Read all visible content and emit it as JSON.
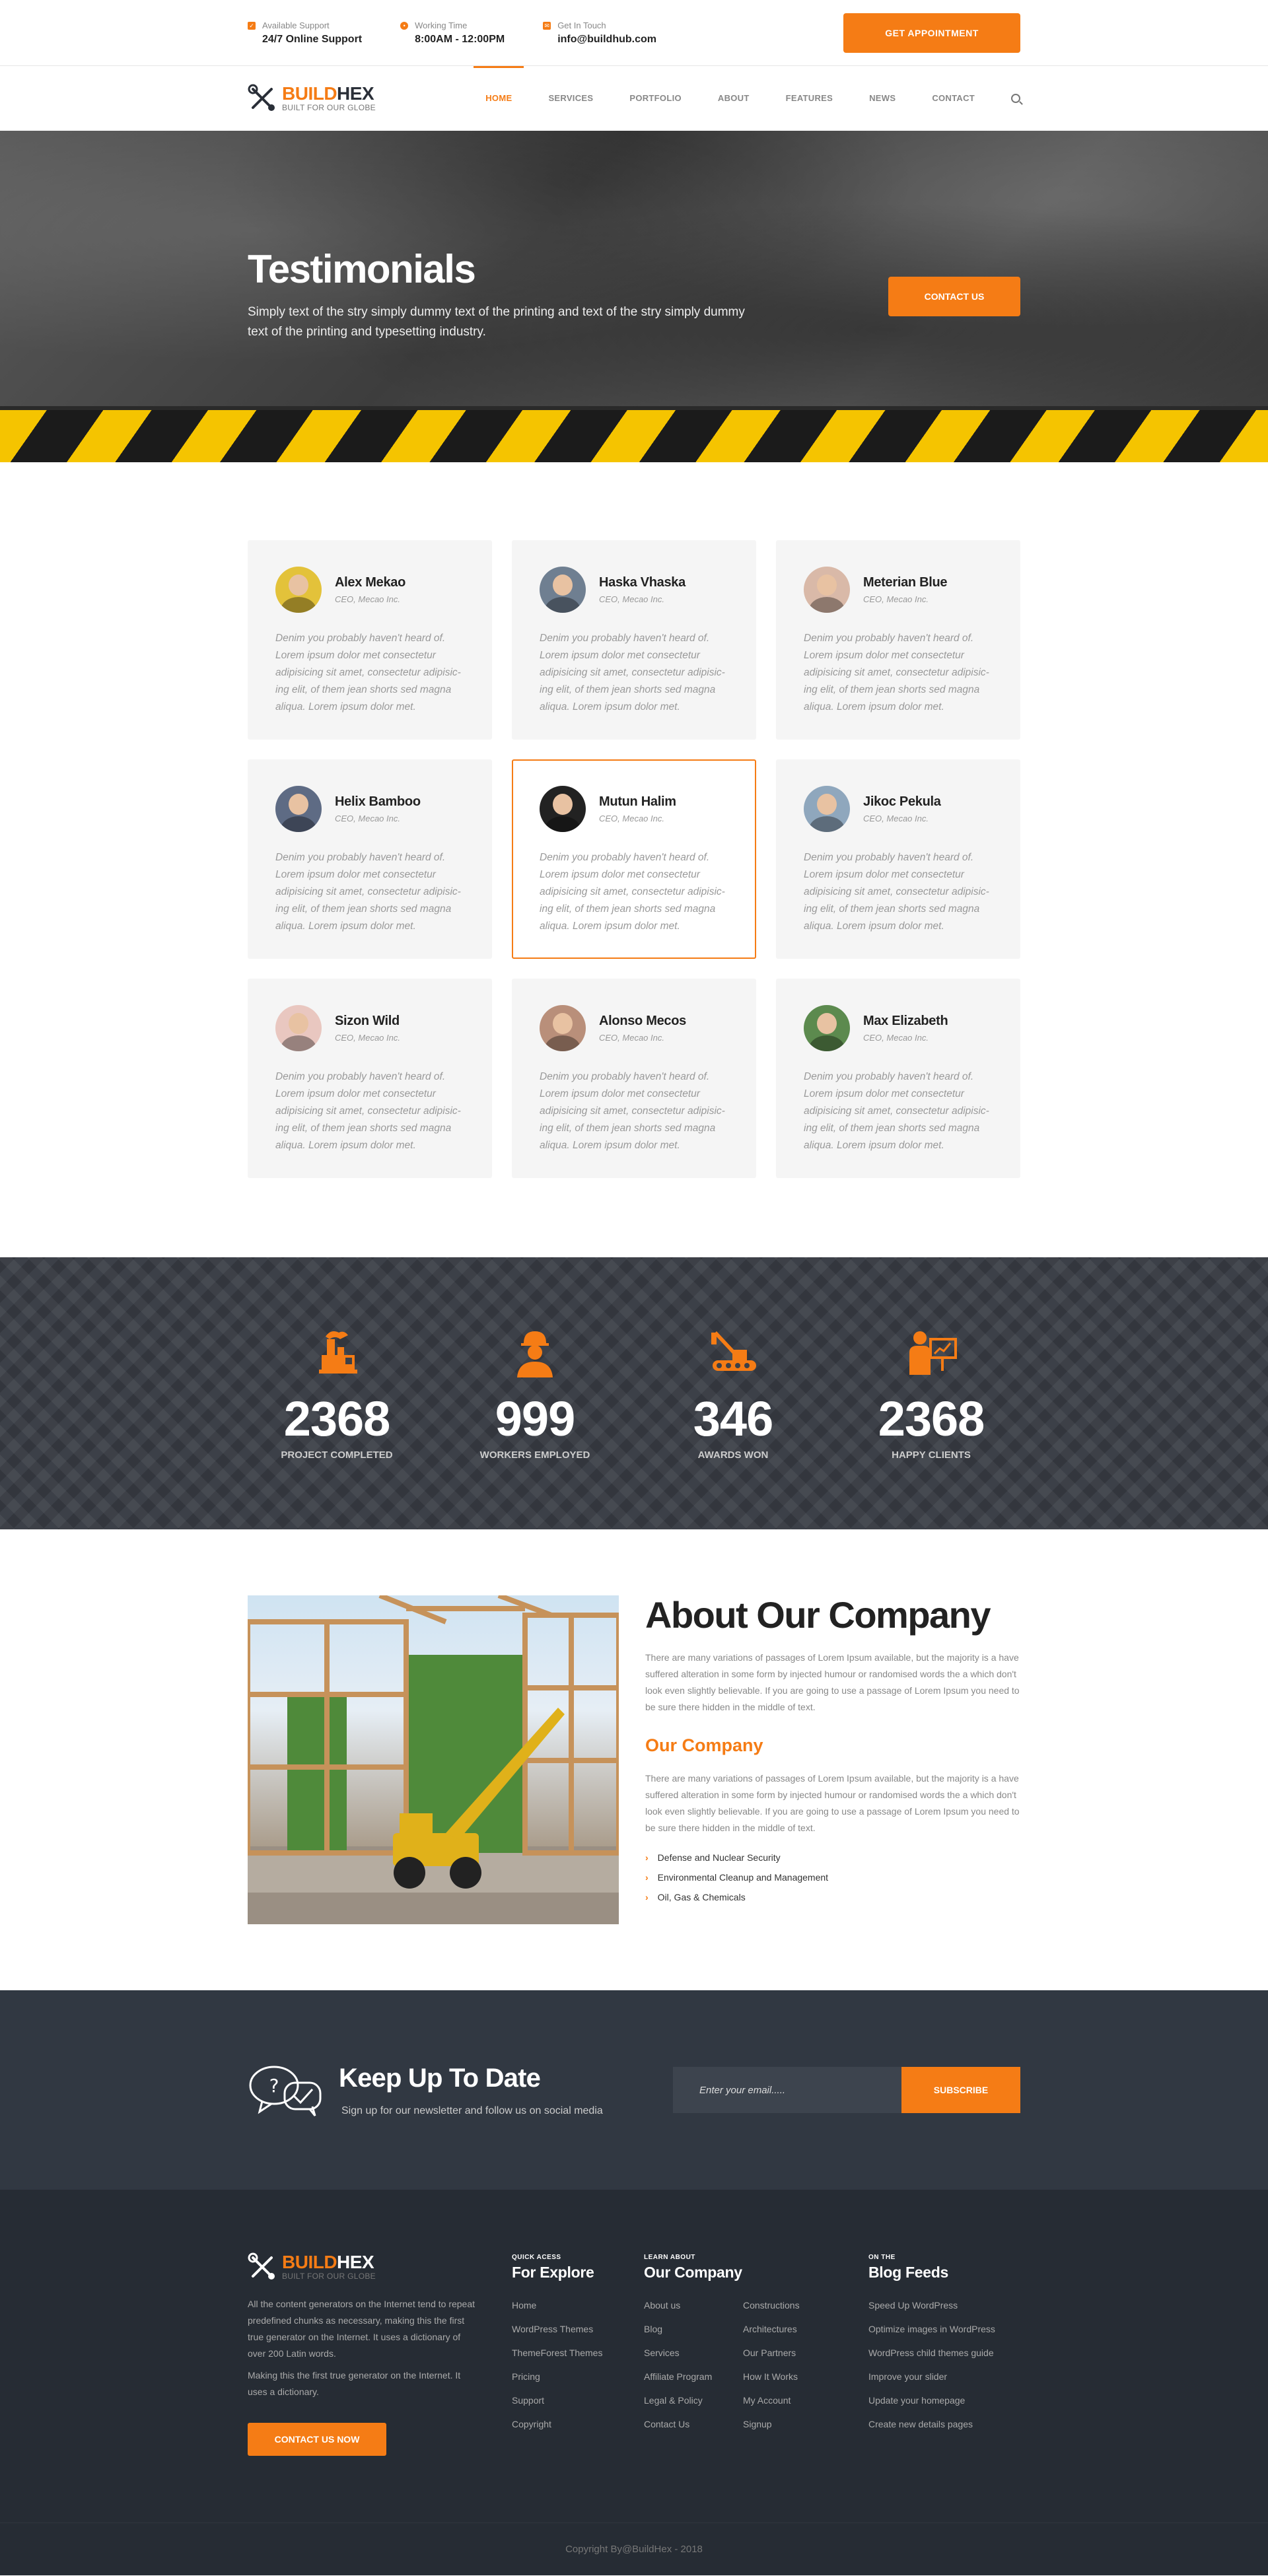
{
  "topbar": {
    "support": {
      "label": "Available Support",
      "value": "24/7 Online Support"
    },
    "hours": {
      "label": "Working Time",
      "value": "8:00AM - 12:00PM"
    },
    "contact": {
      "label": "Get In Touch",
      "value": "info@buildhub.com"
    },
    "cta": "GET APPOINTMENT"
  },
  "brand": {
    "name_part1": "BUILD",
    "name_part2": "HEX",
    "tagline": "BUILT FOR OUR GLOBE"
  },
  "nav": {
    "items": [
      {
        "label": "HOME",
        "active": true
      },
      {
        "label": "SERVICES"
      },
      {
        "label": "PORTFOLIO"
      },
      {
        "label": "ABOUT"
      },
      {
        "label": "FEATURES"
      },
      {
        "label": "NEWS"
      },
      {
        "label": "CONTACT"
      }
    ]
  },
  "hero": {
    "title": "Testimonials",
    "subtitle": "Simply text of the stry simply dummy text of the printing and text of the stry simply dummy text of the printing and typesetting industry.",
    "cta": "CONTACT US"
  },
  "testimonials": [
    {
      "name": "Alex Mekao",
      "role": "CEO, Mecao Inc.",
      "text": "Denim you probably haven't heard of. Lorem ipsum dolor met consectetur adipisicing sit amet, consectetur adipisic-ing elit, of them jean shorts sed magna aliqua. Lorem ipsum dolor met.",
      "avatar_color": "#e3c23a"
    },
    {
      "name": "Haska Vhaska",
      "role": "CEO, Mecao Inc.",
      "text": "Denim you probably haven't heard of. Lorem ipsum dolor met consectetur adipisicing sit amet, consectetur adipisic-ing elit, of them jean shorts sed magna aliqua. Lorem ipsum dolor met.",
      "avatar_color": "#6f7f91"
    },
    {
      "name": "Meterian Blue",
      "role": "CEO, Mecao Inc.",
      "text": "Denim you probably haven't heard of. Lorem ipsum dolor met consectetur adipisicing sit amet, consectetur adipisic-ing elit, of them jean shorts sed magna aliqua. Lorem ipsum dolor met.",
      "avatar_color": "#d9b9a8"
    },
    {
      "name": "Helix Bamboo",
      "role": "CEO, Mecao Inc.",
      "text": "Denim you probably haven't heard of. Lorem ipsum dolor met consectetur adipisicing sit amet, consectetur adipisic-ing elit, of them jean shorts sed magna aliqua. Lorem ipsum dolor met.",
      "avatar_color": "#5e6b84"
    },
    {
      "name": "Mutun Halim",
      "role": "CEO, Mecao Inc.",
      "text": "Denim you probably haven't heard of. Lorem ipsum dolor met consectetur adipisicing sit amet, consectetur adipisic-ing elit, of them jean shorts sed magna aliqua. Lorem ipsum dolor met.",
      "avatar_color": "#222222"
    },
    {
      "name": "Jikoc Pekula",
      "role": "CEO, Mecao Inc.",
      "text": "Denim you probably haven't heard of. Lorem ipsum dolor met consectetur adipisicing sit amet, consectetur adipisic-ing elit, of them jean shorts sed magna aliqua. Lorem ipsum dolor met.",
      "avatar_color": "#8fa7bd"
    },
    {
      "name": "Sizon Wild",
      "role": "CEO, Mecao Inc.",
      "text": "Denim you probably haven't heard of. Lorem ipsum dolor met consectetur adipisicing sit amet, consectetur adipisic-ing elit, of them jean shorts sed magna aliqua. Lorem ipsum dolor met.",
      "avatar_color": "#e9c7c0"
    },
    {
      "name": "Alonso Mecos",
      "role": "CEO, Mecao Inc.",
      "text": "Denim you probably haven't heard of. Lorem ipsum dolor met consectetur adipisicing sit amet, consectetur adipisic-ing elit, of them jean shorts sed magna aliqua. Lorem ipsum dolor met.",
      "avatar_color": "#b98f7a"
    },
    {
      "name": "Max Elizabeth",
      "role": "CEO, Mecao Inc.",
      "text": "Denim you probably haven't heard of. Lorem ipsum dolor met consectetur adipisicing sit amet, consectetur adipisic-ing elit, of them jean shorts sed magna aliqua. Lorem ipsum dolor met.",
      "avatar_color": "#5c8a4e"
    }
  ],
  "stats": [
    {
      "value": "2368",
      "label": "PROJECT COMPLETED",
      "icon": "factory-icon"
    },
    {
      "value": "999",
      "label": "WORKERS EMPLOYED",
      "icon": "worker-icon"
    },
    {
      "value": "346",
      "label": "AWARDS WON",
      "icon": "crane-icon"
    },
    {
      "value": "2368",
      "label": "HAPPY CLIENTS",
      "icon": "presenter-icon"
    }
  ],
  "about": {
    "title": "About Our Company",
    "paragraph1": "There are many variations of passages of Lorem Ipsum available, but the majority is a have suffered alteration in some form by injected humour or randomised words the a which don't look even slightly believable. If you are going to use a passage of Lorem Ipsum you need to be sure there hidden in the middle of text.",
    "subtitle": "Our Company",
    "paragraph2": "There are many variations of passages of Lorem Ipsum available, but the majority is a have suffered alteration in some form by injected humour or randomised words the a which don't look even slightly believable. If you are going to use a passage of Lorem Ipsum you need to be sure there hidden in the middle of text.",
    "list": [
      "Defense and Nuclear Security",
      "Environmental Cleanup and Management",
      "Oil, Gas & Chemicals"
    ]
  },
  "newsletter": {
    "title": "Keep Up To Date",
    "subtitle": "Sign up for our newsletter and follow us on social media",
    "placeholder": "Enter your email.....",
    "button": "SUBSCRIBE"
  },
  "footer": {
    "desc1": "All the content generators on the Internet tend to repeat predefined chunks as necessary, making this the first true generator on the Internet. It uses a dictionary of over 200 Latin words.",
    "desc2": "Making this the first true generator on the Internet. It uses a dictionary.",
    "cta": "CONTACT US NOW",
    "explore": {
      "eyebrow": "QUICK ACESS",
      "title": "For Explore",
      "links": [
        "Home",
        "WordPress Themes",
        "ThemeForest Themes",
        "Pricing",
        "Support",
        "Copyright"
      ]
    },
    "company": {
      "eyebrow": "LEARN ABOUT",
      "title": "Our Company",
      "links_a": [
        "About us",
        "Blog",
        "Services",
        "Affiliate Program",
        "Legal & Policy",
        "Contact Us"
      ],
      "links_b": [
        "Constructions",
        "Architectures",
        "Our Partners",
        "How It Works",
        "My Account",
        "Signup"
      ]
    },
    "blog": {
      "eyebrow": "ON THE",
      "title": "Blog Feeds",
      "links": [
        "Speed Up WordPress",
        "Optimize images in WordPress",
        "WordPress child themes guide",
        "Improve your slider",
        "Update your homepage",
        "Create new details pages"
      ]
    },
    "copyright": "Copyright By@BuildHex - 2018"
  },
  "colors": {
    "accent": "#f57c15",
    "dark": "#2a2f38",
    "hazard_yellow": "#f5c400"
  }
}
